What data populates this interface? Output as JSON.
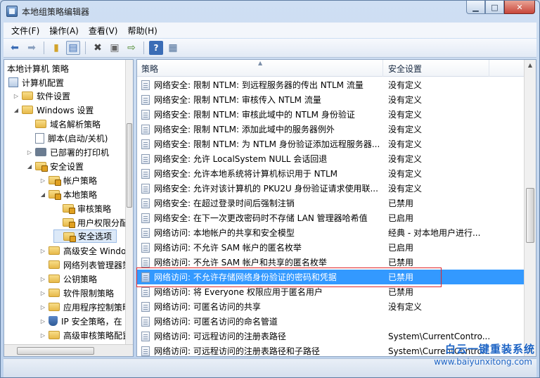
{
  "window": {
    "title": "本地组策略编辑器",
    "controls": {
      "minimize": "▁",
      "maximize": "□",
      "close": "✕"
    }
  },
  "menubar": {
    "items": [
      "文件(F)",
      "操作(A)",
      "查看(V)",
      "帮助(H)"
    ]
  },
  "toolbar": {
    "buttons": [
      "back-icon",
      "forward-icon",
      "up-folder-icon",
      "show-hide-tree-icon",
      "delete-icon",
      "properties-icon",
      "export-icon",
      "help-icon",
      "view-icon"
    ]
  },
  "tree": {
    "items": [
      {
        "label": "本地计算机 策略",
        "toggle": ""
      },
      {
        "label": "计算机配置",
        "toggle": ""
      },
      {
        "label": "软件设置",
        "toggle": "▷"
      },
      {
        "label": "Windows 设置",
        "toggle": "◢"
      },
      {
        "label": "域名解析策略",
        "toggle": ""
      },
      {
        "label": "脚本(启动/关机)",
        "toggle": ""
      },
      {
        "label": "已部署的打印机",
        "toggle": "▷"
      },
      {
        "label": "安全设置",
        "toggle": "◢"
      },
      {
        "label": "帐户策略",
        "toggle": "▷"
      },
      {
        "label": "本地策略",
        "toggle": "◢"
      },
      {
        "label": "审核策略",
        "toggle": ""
      },
      {
        "label": "用户权限分配",
        "toggle": ""
      },
      {
        "label": "安全选项",
        "toggle": ""
      },
      {
        "label": "高级安全 Windows",
        "toggle": "▷"
      },
      {
        "label": "网络列表管理器策略",
        "toggle": ""
      },
      {
        "label": "公钥策略",
        "toggle": "▷"
      },
      {
        "label": "软件限制策略",
        "toggle": "▷"
      },
      {
        "label": "应用程序控制策略",
        "toggle": "▷"
      },
      {
        "label": "IP 安全策略，在",
        "toggle": "▷"
      },
      {
        "label": "高级审核策略配置",
        "toggle": "▷"
      }
    ]
  },
  "list": {
    "headers": {
      "policy": "策略",
      "setting": "安全设置",
      "sort_indicator": "▲"
    },
    "rows": [
      {
        "name": "网络安全: 限制 NTLM: 到远程服务器的传出 NTLM 流量",
        "value": "没有定义"
      },
      {
        "name": "网络安全: 限制 NTLM: 审核传入 NTLM 流量",
        "value": "没有定义"
      },
      {
        "name": "网络安全: 限制 NTLM: 审核此域中的 NTLM 身份验证",
        "value": "没有定义"
      },
      {
        "name": "网络安全: 限制 NTLM: 添加此域中的服务器例外",
        "value": "没有定义"
      },
      {
        "name": "网络安全: 限制 NTLM: 为 NTLM 身份验证添加远程服务器...",
        "value": "没有定义"
      },
      {
        "name": "网络安全: 允许 LocalSystem NULL 会话回退",
        "value": "没有定义"
      },
      {
        "name": "网络安全: 允许本地系统将计算机标识用于 NTLM",
        "value": "没有定义"
      },
      {
        "name": "网络安全: 允许对该计算机的 PKU2U 身份验证请求使用联...",
        "value": "没有定义"
      },
      {
        "name": "网络安全: 在超过登录时间后强制注销",
        "value": "已禁用"
      },
      {
        "name": "网络安全: 在下一次更改密码时不存储 LAN 管理器哈希值",
        "value": "已启用"
      },
      {
        "name": "网络访问: 本地帐户的共享和安全模型",
        "value": "经典 - 对本地用户进行..."
      },
      {
        "name": "网络访问: 不允许 SAM 帐户的匿名枚举",
        "value": "已启用"
      },
      {
        "name": "网络访问: 不允许 SAM 帐户和共享的匿名枚举",
        "value": "已禁用"
      },
      {
        "name": "网络访问: 不允许存储网络身份验证的密码和凭据",
        "value": "已禁用",
        "selected": true
      },
      {
        "name": "网络访问: 将 Everyone 权限应用于匿名用户",
        "value": "已禁用"
      },
      {
        "name": "网络访问: 可匿名访问的共享",
        "value": "没有定义"
      },
      {
        "name": "网络访问: 可匿名访问的命名管道",
        "value": ""
      },
      {
        "name": "网络访问: 可远程访问的注册表路径",
        "value": "System\\CurrentContro..."
      },
      {
        "name": "网络访问: 可远程访问的注册表路径和子路径",
        "value": "System\\CurrentContro..."
      }
    ]
  },
  "watermark": {
    "title": "白云一键重装系统",
    "url": "www.baiyunxitong.com"
  },
  "colors": {
    "selection": "#3399ff",
    "highlight_border": "#e0262b",
    "watermark": "#1c63c4"
  }
}
